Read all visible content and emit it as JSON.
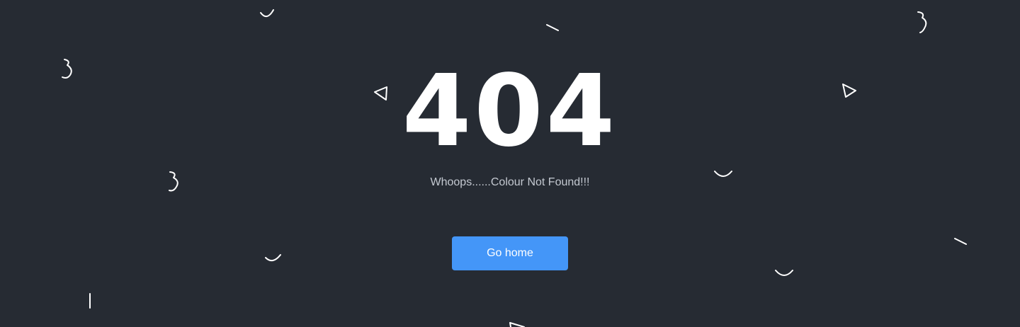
{
  "error": {
    "code": "404",
    "message": "Whoops......Colour Not Found!!!"
  },
  "actions": {
    "home_label": "Go home"
  },
  "colors": {
    "background": "#262b33",
    "code_text": "#ffffff",
    "message_text": "#c4c9d1",
    "button_bg": "#4496f8",
    "button_text": "#ffffff",
    "decor_stroke": "#ffffff"
  },
  "decorations": [
    "arc-icon",
    "line-icon",
    "squiggle-icon",
    "triangle-icon"
  ]
}
